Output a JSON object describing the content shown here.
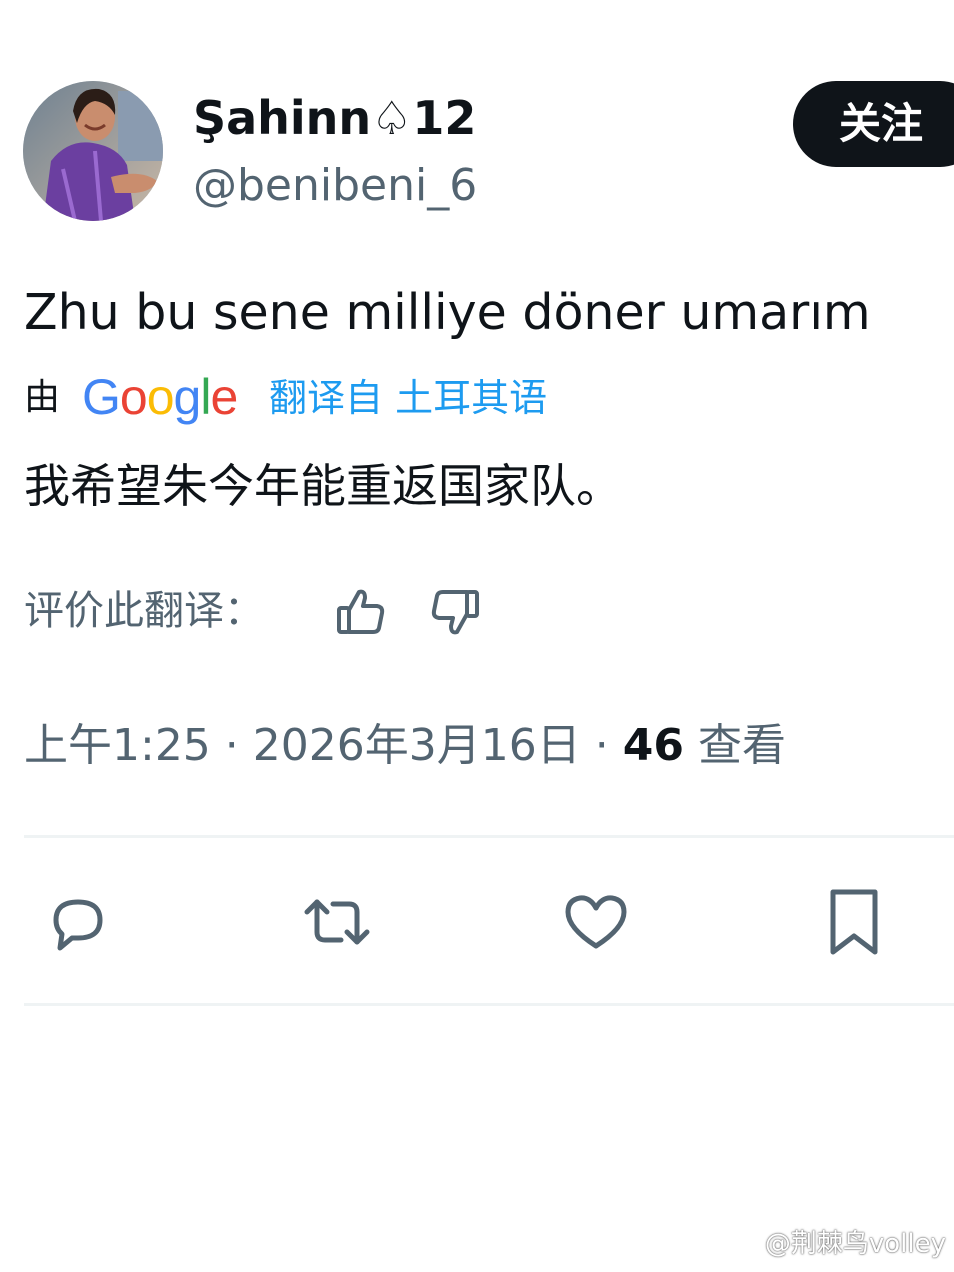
{
  "author": {
    "display_name": "Şahinn♤12",
    "handle": "@benibeni_6",
    "avatar_icon": "player-photo"
  },
  "follow_button": {
    "label": "关注"
  },
  "tweet": {
    "text": "Zhu bu sene milliye döner umarım"
  },
  "translation": {
    "by_label": "由",
    "provider": "Google",
    "translated_from_label": "翻译自 土耳其语",
    "text": "我希望朱今年能重返国家队。"
  },
  "rating": {
    "label": "评价此翻译：",
    "thumbs_up_icon": "thumbs-up-icon",
    "thumbs_down_icon": "thumbs-down-icon"
  },
  "meta": {
    "time": "上午1:25",
    "separator": " · ",
    "date": "2026年3月16日",
    "views_count": "46",
    "views_label": "查看"
  },
  "actions": [
    "reply-icon",
    "retweet-icon",
    "like-icon",
    "bookmark-icon"
  ],
  "watermark": {
    "text": "@荆棘鸟volley"
  },
  "colors": {
    "text_primary": "#0f1419",
    "text_secondary": "#536471",
    "link_blue": "#1d9bf0",
    "divider": "#eff3f4",
    "google_blue": "#4285f4",
    "google_red": "#ea4335",
    "google_yellow": "#fbbc05",
    "google_green": "#34a853"
  }
}
